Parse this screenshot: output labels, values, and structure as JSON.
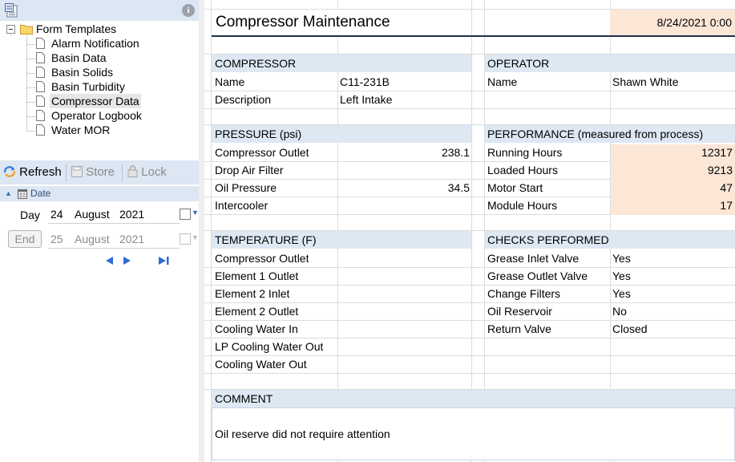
{
  "tree": {
    "root_label": "Form Templates",
    "items": [
      {
        "label": "Alarm Notification"
      },
      {
        "label": "Basin Data"
      },
      {
        "label": "Basin Solids"
      },
      {
        "label": "Basin Turbidity"
      },
      {
        "label": "Compressor Data"
      },
      {
        "label": "Operator Logbook"
      },
      {
        "label": "Water MOR"
      }
    ],
    "selected_index": 4
  },
  "toolbar": {
    "info_glyph": "i"
  },
  "actions": {
    "refresh": "Refresh",
    "store": "Store",
    "lock": "Lock"
  },
  "date_panel": {
    "header": "Date",
    "day_label": "Day",
    "day": {
      "d": "24",
      "m": "August",
      "y": "2021"
    },
    "end_label": "End",
    "end": {
      "d": "25",
      "m": "August",
      "y": "2021"
    }
  },
  "form": {
    "title": "Compressor Maintenance",
    "datetime": "8/24/2021 0:00",
    "compressor": {
      "header": "COMPRESSOR",
      "rows": [
        {
          "label": "Name",
          "value": "C11-231B"
        },
        {
          "label": "Description",
          "value": "Left Intake"
        }
      ]
    },
    "operator": {
      "header": "OPERATOR",
      "rows": [
        {
          "label": "Name",
          "value": "Shawn White"
        }
      ]
    },
    "pressure": {
      "header": "PRESSURE (psi)",
      "rows": [
        {
          "label": "Compressor Outlet",
          "value": "238.1"
        },
        {
          "label": "Drop Air Filter",
          "value": ""
        },
        {
          "label": "Oil Pressure",
          "value": "34.5"
        },
        {
          "label": "Intercooler",
          "value": ""
        }
      ]
    },
    "performance": {
      "header": "PERFORMANCE (measured from process)",
      "rows": [
        {
          "label": "Running Hours",
          "value": "12317"
        },
        {
          "label": "Loaded Hours",
          "value": "9213"
        },
        {
          "label": "Motor Start",
          "value": "47"
        },
        {
          "label": "Module Hours",
          "value": "17"
        }
      ]
    },
    "temperature": {
      "header": "TEMPERATURE (F)",
      "rows": [
        {
          "label": "Compressor Outlet",
          "value": ""
        },
        {
          "label": "Element 1 Outlet",
          "value": ""
        },
        {
          "label": "Element 2 Inlet",
          "value": ""
        },
        {
          "label": "Element 2 Outlet",
          "value": ""
        },
        {
          "label": "Cooling Water In",
          "value": ""
        },
        {
          "label": "LP Cooling Water Out",
          "value": ""
        },
        {
          "label": "Cooling Water Out",
          "value": ""
        }
      ]
    },
    "checks": {
      "header": "CHECKS PERFORMED",
      "rows": [
        {
          "label": "Grease Inlet Valve",
          "value": "Yes"
        },
        {
          "label": "Grease Outlet Valve",
          "value": "Yes"
        },
        {
          "label": "Change Filters",
          "value": "Yes"
        },
        {
          "label": "Oil Reservoir",
          "value": "No"
        },
        {
          "label": "Return Valve",
          "value": "Closed"
        }
      ]
    },
    "comment": {
      "header": "COMMENT",
      "text": "Oil reserve did not require attention"
    }
  },
  "colors": {
    "section_header": "#dde8f3",
    "highlight": "#fce6d6",
    "panel_header": "#dde6f3"
  }
}
